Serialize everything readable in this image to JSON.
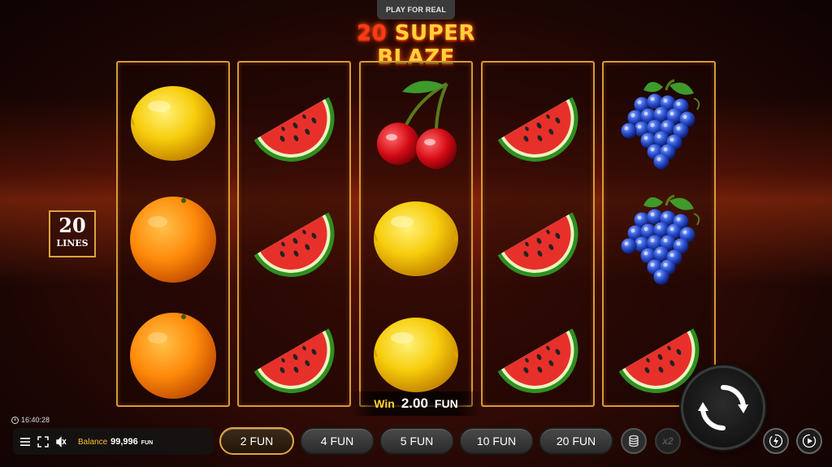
{
  "top": {
    "play_for_real": "PLAY FOR REAL"
  },
  "title": {
    "number": "20",
    "name": "SUPER BLAZE"
  },
  "lines_badge": {
    "number": "20",
    "label": "LINES"
  },
  "reels": [
    [
      "lemon",
      "orange",
      "orange"
    ],
    [
      "watermelon",
      "watermelon",
      "watermelon"
    ],
    [
      "cherry",
      "lemon",
      "lemon"
    ],
    [
      "watermelon",
      "watermelon",
      "watermelon"
    ],
    [
      "grapes",
      "grapes",
      "watermelon"
    ]
  ],
  "win": {
    "label": "Win",
    "amount": "2.00",
    "currency": "FUN"
  },
  "clock": {
    "time": "16:40:28"
  },
  "balance": {
    "label": "Balance",
    "value": "99,996",
    "currency": "FUN"
  },
  "bets": [
    {
      "label": "2 FUN",
      "selected": true
    },
    {
      "label": "4 FUN",
      "selected": false
    },
    {
      "label": "5 FUN",
      "selected": false
    },
    {
      "label": "10 FUN",
      "selected": false
    },
    {
      "label": "20 FUN",
      "selected": false
    }
  ],
  "gamble": {
    "label": "x2"
  },
  "icons": {
    "menu": "menu-icon",
    "fullscreen": "fullscreen-icon",
    "sound": "sound-off-icon",
    "coins": "coin-stack-icon",
    "spin": "spin-arrows-icon",
    "turbo": "turbo-icon",
    "autoplay": "autoplay-icon"
  },
  "colors": {
    "accent": "#ffd23a",
    "reel_border": "#d79a35",
    "selected_border": "#e0a640"
  }
}
